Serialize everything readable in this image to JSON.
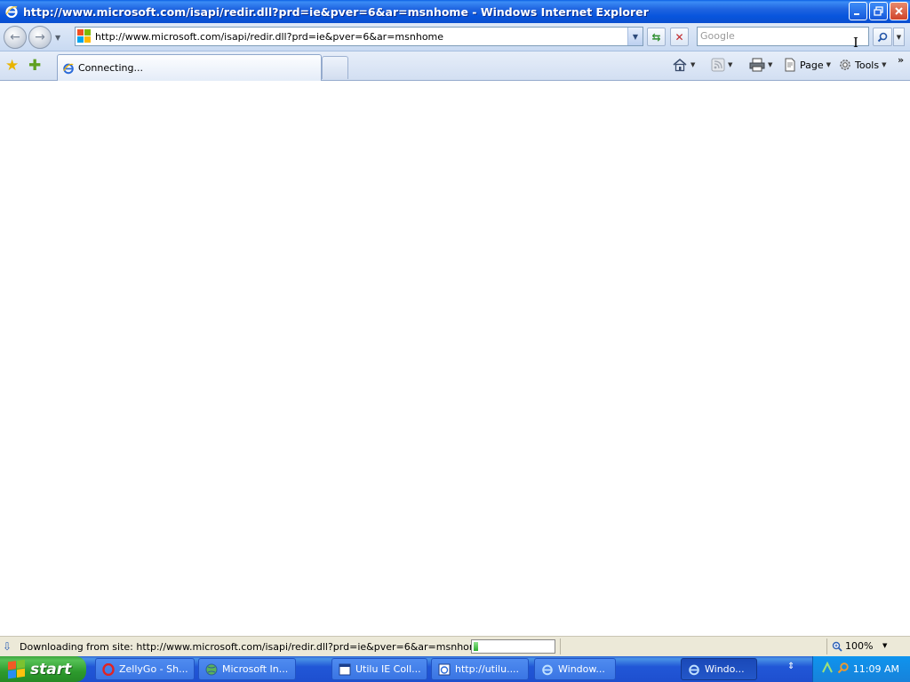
{
  "window": {
    "title": "http://www.microsoft.com/isapi/redir.dll?prd=ie&pver=6&ar=msnhome - Windows Internet Explorer",
    "controls": [
      "minimize",
      "restore",
      "close"
    ]
  },
  "navigation": {
    "address": "http://www.microsoft.com/isapi/redir.dll?prd=ie&pver=6&ar=msnhome",
    "search_placeholder": "Google"
  },
  "tab": {
    "label": "Connecting..."
  },
  "command_bar": {
    "page_label": "Page",
    "tools_label": "Tools"
  },
  "status_bar": {
    "text": "Downloading from site: http://www.microsoft.com/isapi/redir.dll?prd=ie&pver=6&ar=msnhome",
    "progress": 0.06,
    "zoom": "100%"
  },
  "taskbar": {
    "start_label": "start",
    "tasks": [
      {
        "label": "ZellyGo - Sh...",
        "icon": "opera-icon"
      },
      {
        "label": "Microsoft In...",
        "icon": "ie-globe-icon"
      },
      {
        "label": "Utilu IE Coll...",
        "icon": "window-icon"
      },
      {
        "label": "http://utilu....",
        "icon": "ie-page-icon"
      },
      {
        "label": "Window...",
        "icon": "ie-icon"
      },
      {
        "label": "Windo...",
        "icon": "ie-icon",
        "active": true
      }
    ],
    "clock": "11:09 AM"
  },
  "colors": {
    "titlebar": "#0a55dd",
    "taskbar": "#2157d7",
    "start": "#2d9a2d",
    "tray": "#1782da"
  }
}
